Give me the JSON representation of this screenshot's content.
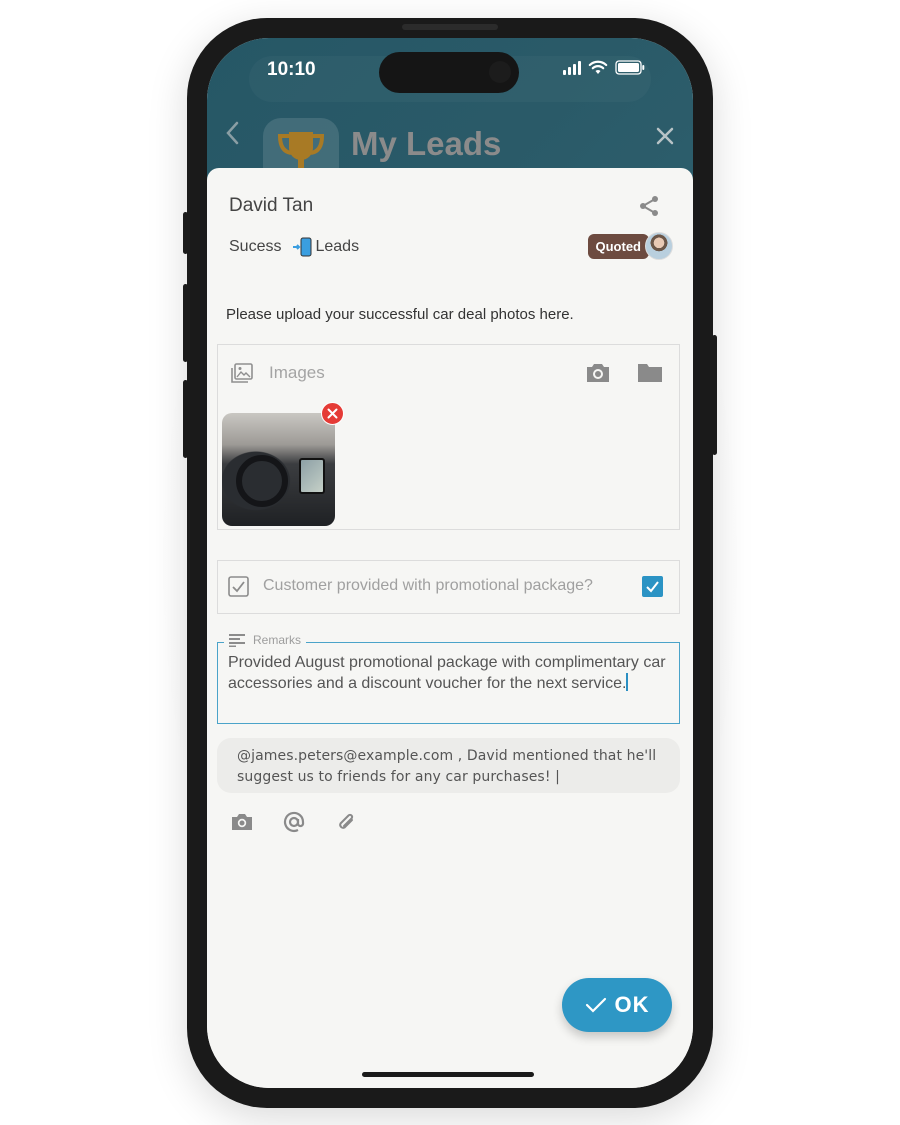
{
  "status_bar": {
    "time": "10:10"
  },
  "header": {
    "title": "My Leads",
    "back_icon": "chevron-left-icon",
    "close_icon": "close-icon",
    "app_icon": "trophy-icon"
  },
  "lead": {
    "name": "David Tan",
    "stage": "Sucess",
    "pipeline": "Leads",
    "status_badge": "Quoted",
    "status_color": "#6d4b40"
  },
  "form": {
    "instruction": "Please upload your successful car deal photos here.",
    "images": {
      "label": "Images",
      "count": 1
    },
    "promo_question": {
      "label": "Customer provided with promotional package?",
      "checked": true
    },
    "remarks": {
      "label": "Remarks",
      "value": "Provided August promotional package with complimentary car accessories and a discount voucher for the next service."
    },
    "comment": {
      "value": "@james.peters@example.com , David mentioned that he'll suggest us to friends for any car purchases! |"
    }
  },
  "actions": {
    "ok_label": "OK",
    "accent_color": "#2e97c5"
  }
}
